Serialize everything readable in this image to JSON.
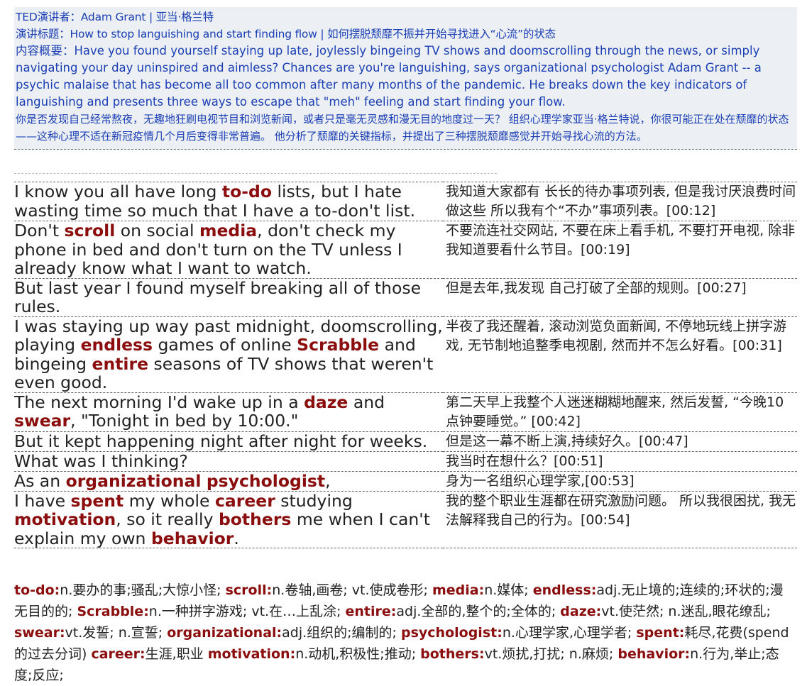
{
  "header": {
    "speaker": "TED演讲者：Adam Grant | 亚当·格兰特",
    "title": "演讲标题：How to stop languishing and start finding flow | 如何摆脱颓靡不振并开始寻找进入“心流”的状态",
    "summary_en": "内容概要：Have you found yourself staying up late, joylessly bingeing TV shows and doomscrolling through the news, or simply navigating your day uninspired and aimless? Chances are you're languishing, says organizational psychologist Adam Grant -- a psychic malaise that has become all too common after many months of the pandemic. He breaks down the key indicators of languishing and presents three ways to escape that \"meh\" feeling and start finding your flow.",
    "summary_zh": "你是否发现自己经常熬夜，无趣地狂刷电视节目和浏览新闻，或者只是毫无灵感和漫无目的地度过一天？ 组织心理学家亚当·格兰特说，你很可能正在处在颓靡的状态——这种心理不适在新冠疫情几个月后变得非常普遍。 他分析了颓靡的关键指标，并提出了三种摆脱颓靡感觉并开始寻找心流的方法。"
  },
  "lines": [
    {
      "en": [
        [
          "I know you all have long ",
          false
        ],
        [
          "to-do",
          true
        ],
        [
          " lists, but I hate wasting time so much that I have a to-don't list.",
          false
        ]
      ],
      "zh": "我知道大家都有 长长的待办事项列表, 但是我讨厌浪费时间做这些 所以我有个“不办”事项列表。[00:12]"
    },
    {
      "en": [
        [
          "Don't ",
          false
        ],
        [
          "scroll",
          true
        ],
        [
          " on social ",
          false
        ],
        [
          "media",
          true
        ],
        [
          ", don't check my phone in bed and don't turn on the TV unless I already know what I want to watch.",
          false
        ]
      ],
      "zh": "不要流连社交网站, 不要在床上看手机, 不要打开电视, 除非我知道要看什么节目。[00:19]"
    },
    {
      "en": [
        [
          "But last year I found myself breaking all of those rules.",
          false
        ]
      ],
      "zh": "但是去年,我发现 自己打破了全部的规则。[00:27]"
    },
    {
      "en": [
        [
          "I was staying up way past midnight, doomscrolling, playing ",
          false
        ],
        [
          "endless",
          true
        ],
        [
          " games of online ",
          false
        ],
        [
          "Scrabble",
          true
        ],
        [
          " and bingeing ",
          false
        ],
        [
          "entire",
          true
        ],
        [
          " seasons of TV shows that weren't even good.",
          false
        ]
      ],
      "zh": "半夜了我还醒着, 滚动浏览负面新闻, 不停地玩线上拼字游戏, 无节制地追整季电视剧, 然而并不怎么好看。[00:31]"
    },
    {
      "en": [
        [
          "The next morning I'd wake up in a ",
          false
        ],
        [
          "daze",
          true
        ],
        [
          " and ",
          false
        ],
        [
          "swear",
          true
        ],
        [
          ", \"Tonight in bed by 10:00.\"",
          false
        ]
      ],
      "zh": "第二天早上我整个人迷迷糊糊地醒来, 然后发誓, “今晚10点钟要睡觉。” [00:42]"
    },
    {
      "en": [
        [
          "But it kept happening night after night for weeks.",
          false
        ]
      ],
      "zh": "但是这一幕不断上演,持续好久。[00:47]"
    },
    {
      "en": [
        [
          "What was I thinking?",
          false
        ]
      ],
      "zh": "我当时在想什么？[00:51]"
    },
    {
      "en": [
        [
          "As an ",
          false
        ],
        [
          "organizational",
          true
        ],
        [
          " ",
          false
        ],
        [
          "psychologist",
          true
        ],
        [
          ",",
          false
        ]
      ],
      "zh": "身为一名组织心理学家,[00:53]"
    },
    {
      "en": [
        [
          "I have ",
          false
        ],
        [
          "spent",
          true
        ],
        [
          " my whole ",
          false
        ],
        [
          "career",
          true
        ],
        [
          " studying ",
          false
        ],
        [
          "motivation",
          true
        ],
        [
          ", so it really ",
          false
        ],
        [
          "bothers",
          true
        ],
        [
          " me when I can't explain my own ",
          false
        ],
        [
          "behavior",
          true
        ],
        [
          ".",
          false
        ]
      ],
      "zh": "我的整个职业生涯都在研究激励问题。 所以我很困扰, 我无法解释我自己的行为。[00:54]"
    }
  ],
  "glossary": [
    [
      "to-do:",
      "n.要办的事;骚乱;大惊小怪; "
    ],
    [
      "scroll:",
      "n.卷轴,画卷; vt.使成卷形; "
    ],
    [
      "media:",
      "n.媒体; "
    ],
    [
      "endless:",
      "adj.无止境的;连续的;环状的;漫无目的的; "
    ],
    [
      "Scrabble:",
      "n.一种拼字游戏; vt.在…上乱涂; "
    ],
    [
      "entire:",
      "adj.全部的,整个的;全体的; "
    ],
    [
      "daze:",
      "vt.使茫然; n.迷乱,眼花缭乱; "
    ],
    [
      "swear:",
      "vt.发誓; n.宣誓; "
    ],
    [
      "organizational:",
      "adj.组织的;编制的; "
    ],
    [
      "psychologist:",
      "n.心理学家,心理学者; "
    ],
    [
      "spent:",
      "耗尽,花费(spend的过去分词) "
    ],
    [
      "career:",
      "生涯,职业 "
    ],
    [
      "motivation:",
      "n.动机,积极性;推动; "
    ],
    [
      "bothers:",
      "vt.烦扰,打扰; n.麻烦; "
    ],
    [
      "behavior:",
      "n.行为,举止;态度;反应; "
    ]
  ]
}
